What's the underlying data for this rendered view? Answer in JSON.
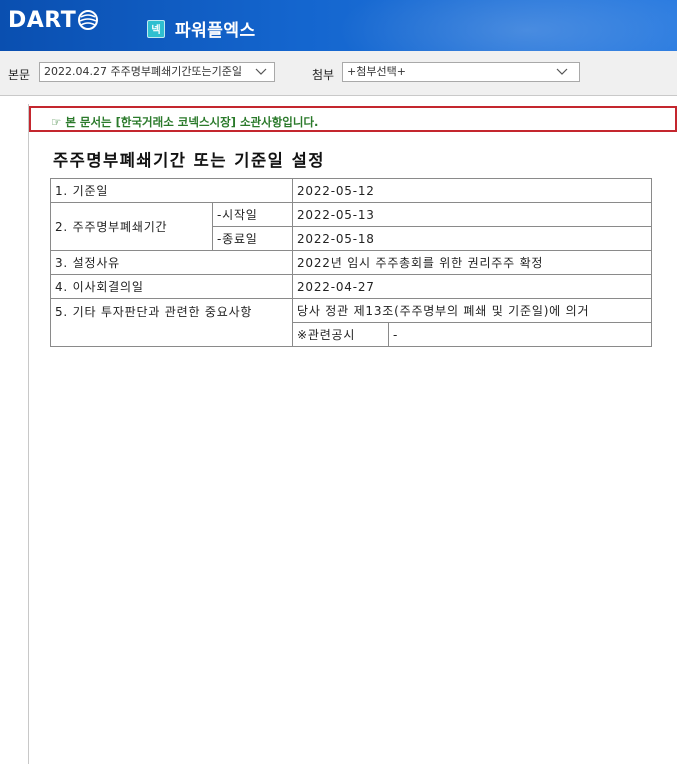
{
  "header": {
    "logo_text": "DART",
    "company_badge": "넥",
    "company_name": "파워플엑스"
  },
  "toolbar": {
    "body_label": "본문",
    "body_select_value": "2022.04.27 주주명부폐쇄기간또는기준일",
    "attach_label": "첨부",
    "attach_select_value": "+첨부선택+"
  },
  "notice": {
    "text": "☞ 본 문서는 [한국거래소 코넥스시장] 소관사항입니다."
  },
  "document": {
    "title": "주주명부폐쇄기간 또는 기준일 설정",
    "rows": {
      "record_date_label": "1. 기준일",
      "record_date_value": "2022-05-12",
      "closure_period_label": "2. 주주명부폐쇄기간",
      "start_label": "-시작일",
      "start_value": "2022-05-13",
      "end_label": "-종료일",
      "end_value": "2022-05-18",
      "reason_label": "3. 설정사유",
      "reason_value": "2022년 임시 주주총회를 위한 권리주주 확정",
      "board_date_label": "4. 이사회결의일",
      "board_date_value": "2022-04-27",
      "other_label": "5. 기타 투자판단과 관련한 중요사항",
      "other_value": "당사 정관 제13조(주주명부의 폐쇄 및 기준일)에 의거",
      "related_label": "※관련공시",
      "related_value": "-"
    }
  }
}
